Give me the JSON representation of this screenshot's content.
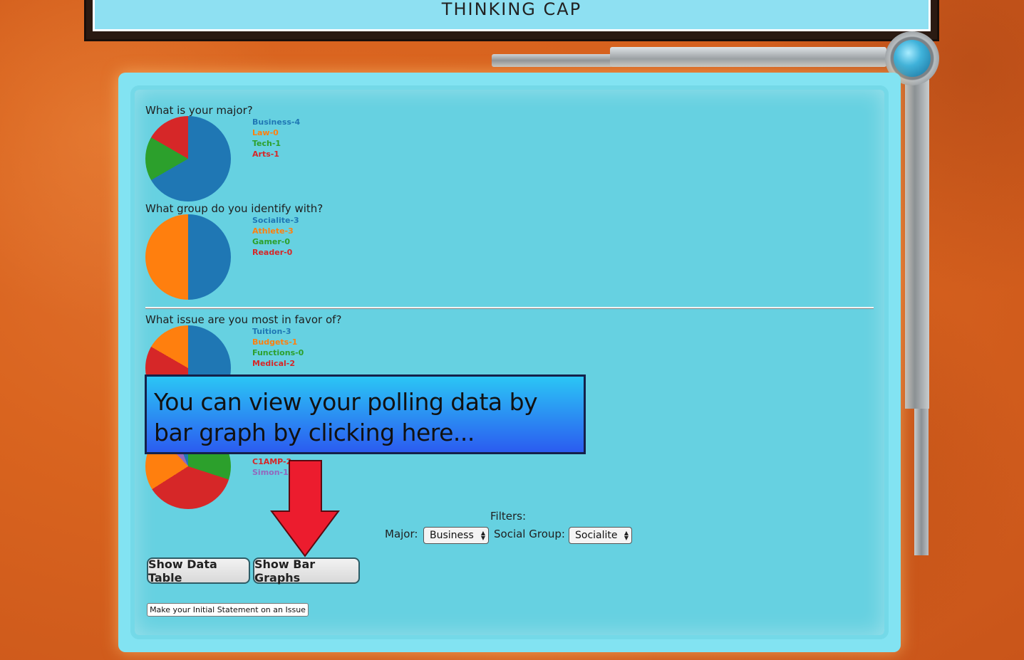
{
  "header": {
    "title": "THINKING CAP"
  },
  "questions": [
    {
      "text": "What is your major?",
      "legend": [
        "Business-4",
        "Law-0",
        "Tech-1",
        "Arts-1"
      ],
      "slices": [
        4,
        0,
        1,
        1
      ]
    },
    {
      "text": "What group do you identify with?",
      "legend": [
        "Socialite-3",
        "Athlete-3",
        "Gamer-0",
        "Reader-0"
      ],
      "slices": [
        3,
        3,
        0,
        0
      ]
    },
    {
      "text": "What issue are you most in favor of?",
      "legend": [
        "Tuition-3",
        "Budgets-1",
        "Functions-0",
        "Medical-2"
      ],
      "slices": [
        3,
        1,
        0,
        2
      ]
    },
    {
      "text": "",
      "legend": [
        "C1AMP-2",
        "Simon-1"
      ]
    }
  ],
  "series_colors": {
    "blue": "#1f77b4",
    "orange": "#ff7f0e",
    "green": "#2ca02c",
    "red": "#d62728",
    "purple": "#9467bd"
  },
  "callout": {
    "text": "You can view your polling data by bar graph by clicking here..."
  },
  "filters": {
    "title": "Filters:",
    "major_label": "Major:",
    "major_value": "Business",
    "social_label": "Social Group:",
    "social_value": "Socialite"
  },
  "buttons": {
    "show_table": "Show Data Table",
    "show_bars": "Show Bar Graphs",
    "initial_statement": "Make your Initial Statement on an Issue"
  },
  "icons": {
    "arrow": "down-arrow-icon",
    "knob": "pipe-knob-icon"
  }
}
